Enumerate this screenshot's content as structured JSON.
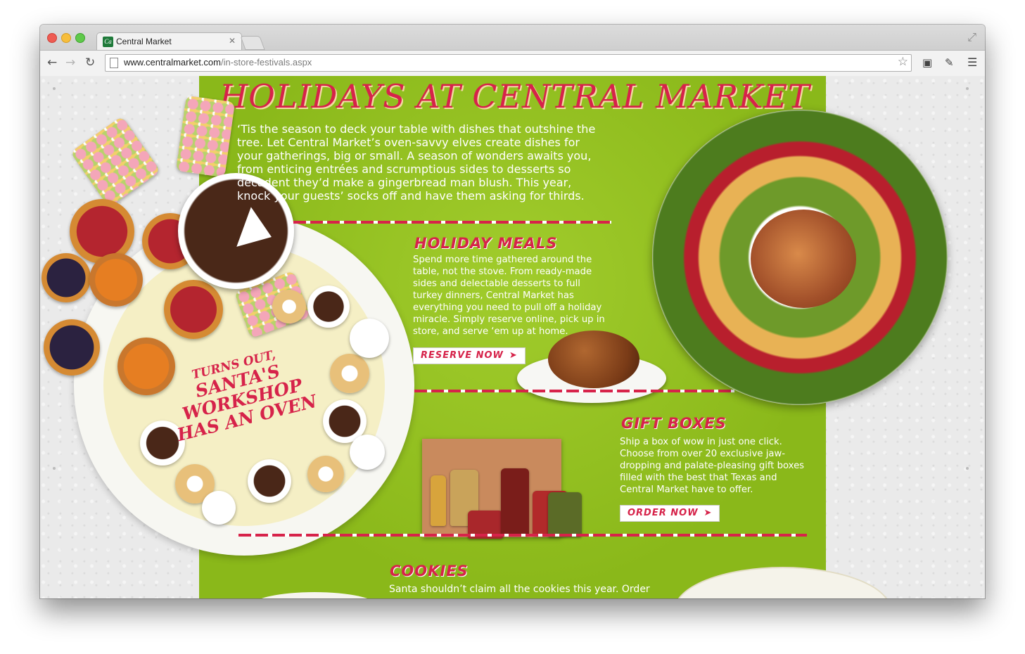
{
  "browser": {
    "tab_title": "Central Market",
    "tab_close": "✕",
    "favicon": "Ca",
    "url_host": "www.centralmarket.com",
    "url_path": "/in-store-festivals.aspx",
    "icons": {
      "back": "back-arrow-icon",
      "forward": "forward-arrow-icon",
      "reload": "reload-icon",
      "star": "bookmark-star-icon",
      "menu": "hamburger-menu-icon"
    }
  },
  "page": {
    "headline": "HOLIDAYS AT CENTRAL MARKET",
    "intro": "‘Tis the season to deck your table with dishes that outshine the tree. Let Central Market’s oven-savvy elves create dishes for your gatherings, big or small. A season of wonders awaits you, from enticing entrées and scrumptious sides to desserts so decadent they’d make a gingerbread man blush. This year, knock your guests’ socks off and have them asking for thirds.",
    "santa": {
      "line1": "TURNS OUT,",
      "line2": "SANTA'S WORKSHOP",
      "line3": "HAS AN OVEN"
    },
    "holiday_meals": {
      "title": "HOLIDAY MEALS",
      "body": "Spend more time gathered around the table, not the stove. From ready-made sides and delectable desserts to full turkey dinners, Central Market has everything you need to pull off a holiday miracle. Simply reserve online, pick up in store, and serve ‘em up at home.",
      "button": "RESERVE NOW"
    },
    "gift_boxes": {
      "title": "GIFT BOXES",
      "body": "Ship a box of wow in just one click. Choose from over 20 exclusive jaw-dropping and palate-pleasing gift boxes filled with the best that Texas and Central Market have to offer.",
      "button": "ORDER NOW"
    },
    "cookies": {
      "title": "COOKIES",
      "body": "Santa shouldn’t claim all the cookies this year. Order your"
    },
    "colors": {
      "accent_red": "#d6234a",
      "panel_green": "#8dbb1d"
    }
  }
}
